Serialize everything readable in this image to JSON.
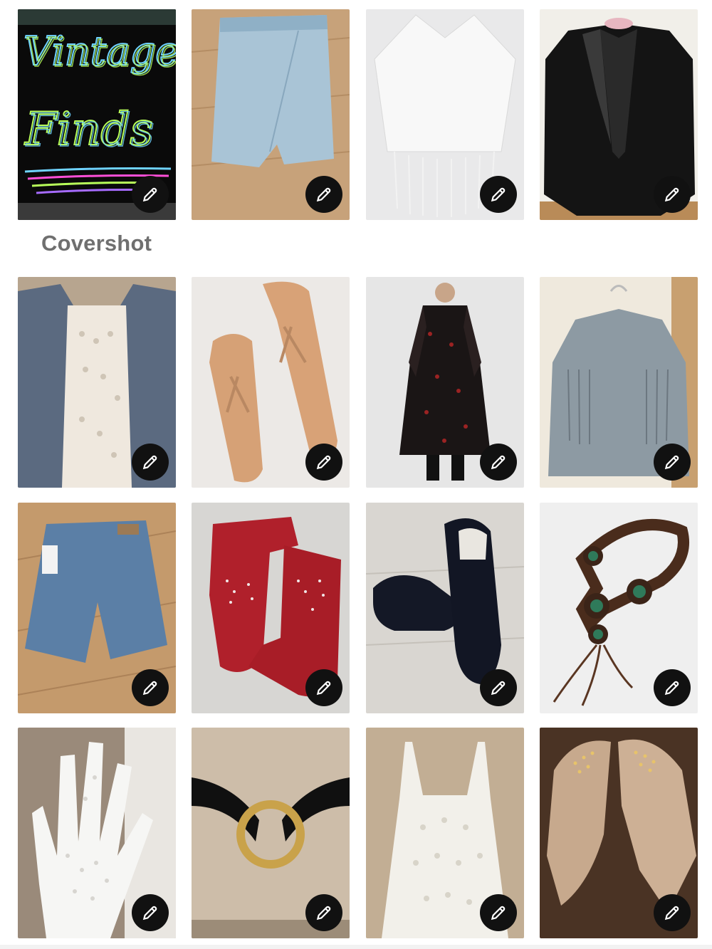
{
  "cover_label": "Covershot",
  "cover_art_text": {
    "line1": "Vintage",
    "line2": "Finds"
  },
  "edit_icon": "pencil-icon",
  "tiles": [
    {
      "name": "vintage-finds-cover"
    },
    {
      "name": "denim-wrap-skort"
    },
    {
      "name": "white-fringe-poncho"
    },
    {
      "name": "black-beaded-blazer"
    },
    {
      "name": "lace-top-denim-jacket"
    },
    {
      "name": "tan-thong-sandals"
    },
    {
      "name": "black-red-floral-sheer-dress"
    },
    {
      "name": "denim-fringe-jacket"
    },
    {
      "name": "denim-cutoff-shorts"
    },
    {
      "name": "red-cowboy-boots"
    },
    {
      "name": "black-suede-loafers"
    },
    {
      "name": "leather-concho-belt"
    },
    {
      "name": "white-crochet-glove"
    },
    {
      "name": "black-ring-belt"
    },
    {
      "name": "white-crochet-tank"
    },
    {
      "name": "studded-suede-booties"
    }
  ],
  "colors": {
    "background": "#ffffff",
    "edit_button": "#111111",
    "label_text": "#6f6f6f"
  }
}
